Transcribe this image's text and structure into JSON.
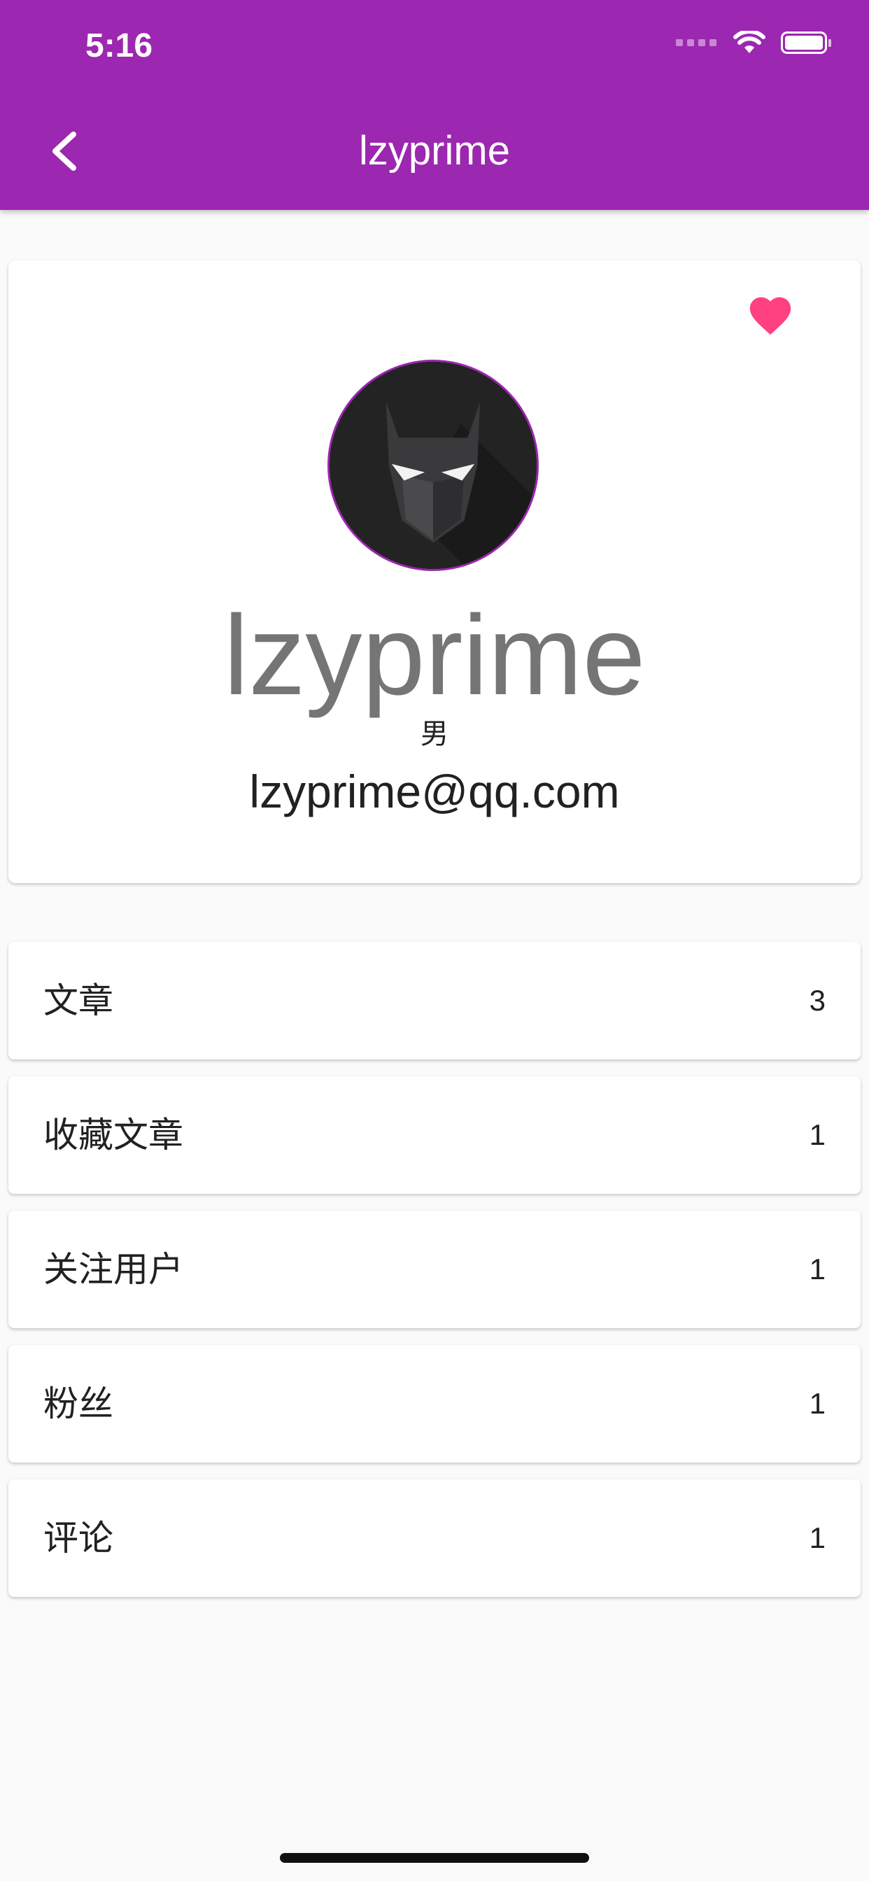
{
  "status_bar": {
    "time": "5:16"
  },
  "app_bar": {
    "title": "lzyprime"
  },
  "profile": {
    "name": "lzyprime",
    "gender": "男",
    "email": "lzyprime@qq.com"
  },
  "stats": [
    {
      "label": "文章",
      "count": "3"
    },
    {
      "label": "收藏文章",
      "count": "1"
    },
    {
      "label": "关注用户",
      "count": "1"
    },
    {
      "label": "粉丝",
      "count": "1"
    },
    {
      "label": "评论",
      "count": "1"
    }
  ],
  "colors": {
    "primary": "#9c27b0",
    "favorite": "#ff4081",
    "background": "#fafafa"
  },
  "icons": {
    "back": "chevron-left-icon",
    "favorite": "heart-icon",
    "wifi": "wifi-icon",
    "battery": "battery-icon"
  }
}
